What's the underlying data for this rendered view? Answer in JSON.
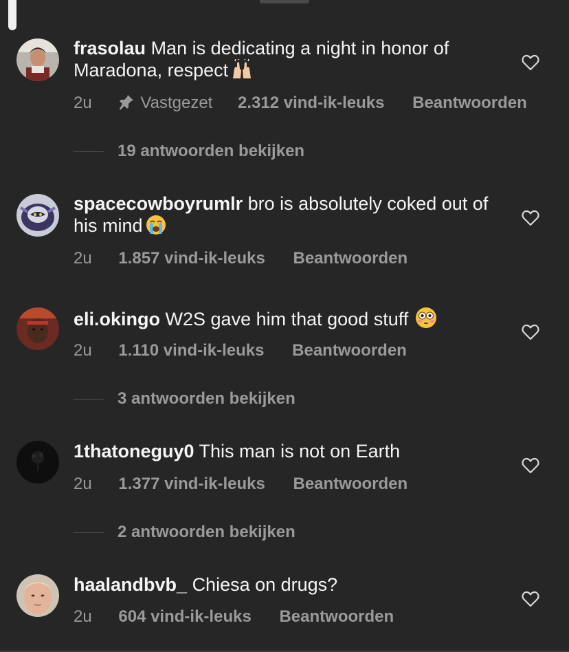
{
  "comments": [
    {
      "username": "frasolau",
      "text": "Man is dedicating a night in honor of Maradona, respect",
      "emoji": "raising-hands",
      "time": "2u",
      "pinned_label": "Vastgezet",
      "likes": "2.312 vind-ik-leuks",
      "reply_label": "Beantwoorden",
      "replies_label": "19 antwoorden bekijken"
    },
    {
      "username": "spacecowboyrumlr",
      "text": "bro is absolutely coked out of his mind",
      "emoji": "loudly-crying-face",
      "time": "2u",
      "likes": "1.857 vind-ik-leuks",
      "reply_label": "Beantwoorden"
    },
    {
      "username": "eli.okingo",
      "text": "W2S gave him that good stuff",
      "emoji": "flushed-face",
      "time": "2u",
      "likes": "1.110 vind-ik-leuks",
      "reply_label": "Beantwoorden",
      "replies_label": "3 antwoorden bekijken"
    },
    {
      "username": "1thatoneguy0",
      "text": "This man is not on Earth",
      "time": "2u",
      "likes": "1.377 vind-ik-leuks",
      "reply_label": "Beantwoorden",
      "replies_label": "2 antwoorden bekijken"
    },
    {
      "username": "haalandbvb_",
      "text": "Chiesa on drugs?",
      "time": "2u",
      "likes": "604 vind-ik-leuks",
      "reply_label": "Beantwoorden"
    }
  ],
  "icons": {
    "like": "heart-outline-icon",
    "pin": "pin-icon"
  },
  "colors": {
    "background": "#262626",
    "text": "#f5f5f5",
    "muted": "#9a9a9a"
  }
}
